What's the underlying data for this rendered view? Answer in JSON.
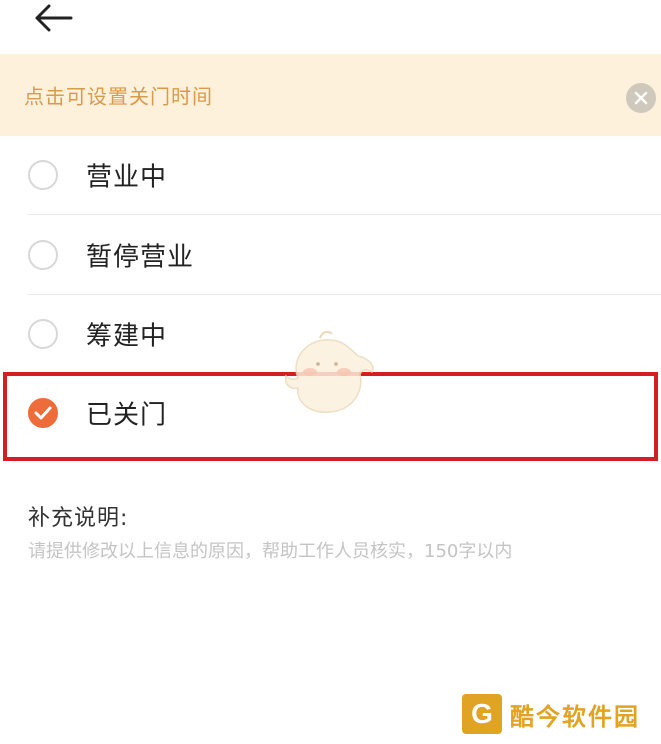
{
  "nav": {
    "back_icon": "arrow-left-icon"
  },
  "notice": {
    "text": "点击可设置关门时间",
    "close_icon": "close-circle-icon"
  },
  "status_options": [
    {
      "label": "营业中",
      "selected": false
    },
    {
      "label": "暂停营业",
      "selected": false
    },
    {
      "label": "筹建中",
      "selected": false
    },
    {
      "label": "已关门",
      "selected": true
    }
  ],
  "supplement": {
    "title": "补充说明:",
    "placeholder": "请提供修改以上信息的原因，帮助工作人员核实，150字以内"
  },
  "colors": {
    "accent": "#ee6b3a",
    "notice_bg": "#fdf1db",
    "notice_text": "#d89a4c",
    "highlight": "#d41e23"
  },
  "watermark": {
    "logo_text": "G",
    "text": "酷今软件园"
  }
}
